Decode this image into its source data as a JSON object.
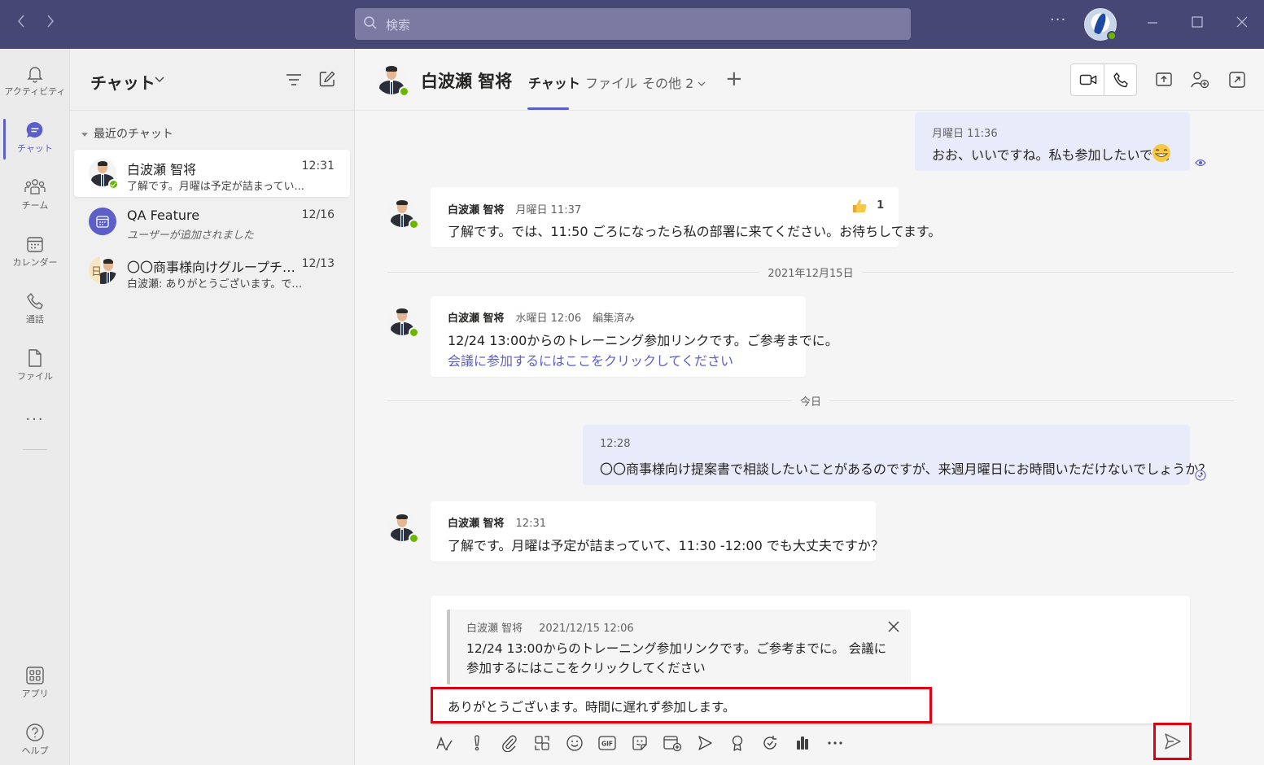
{
  "titlebar": {
    "search_placeholder": "検索",
    "more": "···"
  },
  "rail": {
    "items": [
      {
        "label": "アクティビティ",
        "icon": "bell-icon"
      },
      {
        "label": "チャット",
        "icon": "chat-icon",
        "active": true
      },
      {
        "label": "チーム",
        "icon": "teams-icon"
      },
      {
        "label": "カレンダー",
        "icon": "calendar-icon"
      },
      {
        "label": "通話",
        "icon": "phone-icon"
      },
      {
        "label": "ファイル",
        "icon": "file-icon"
      }
    ],
    "more": "···",
    "apps": "アプリ",
    "help": "ヘルプ"
  },
  "chatlist": {
    "title": "チャット",
    "section": "最近のチャット",
    "items": [
      {
        "name": "白波瀬 智将",
        "time": "12:31",
        "preview": "了解です。月曜は予定が詰まってい..."
      },
      {
        "name": "QA Feature",
        "time": "12/16",
        "preview": "ユーザーが追加されました"
      },
      {
        "name": "〇〇商事様向けグループチャ...",
        "time": "12/13",
        "preview": "白波瀬: ありがとうございます。では、...",
        "initial": "日"
      }
    ]
  },
  "header": {
    "name": "白波瀬 智将",
    "tabs": [
      "チャット",
      "ファイル",
      "その他 2"
    ],
    "plus": "+"
  },
  "messages": {
    "m1": {
      "meta": "月曜日 11:36",
      "text": "おお、いいですね。私も参加したいです。"
    },
    "m2": {
      "sender": "白波瀬 智将",
      "meta": "月曜日 11:37",
      "text": "了解です。では、11:50 ごろになったら私の部署に来てください。お待ちしてます。",
      "reaction_count": "1"
    },
    "sep1": "2021年12月15日",
    "m3": {
      "sender": "白波瀬 智将",
      "meta": "水曜日 12:06",
      "edited": "編集済み",
      "text": "12/24 13:00からのトレーニング参加リンクです。ご参考までに。",
      "link": "会議に参加するにはここをクリックしてください"
    },
    "sep2": "今日",
    "m4": {
      "meta": "12:28",
      "text": "〇〇商事様向け提案書で相談したいことがあるのですが、来週月曜日にお時間いただけないでしょうか？"
    },
    "m5": {
      "sender": "白波瀬 智将",
      "meta": "12:31",
      "text": "了解です。月曜は予定が詰まっていて、11:30 -12:00 でも大丈夫ですか？"
    }
  },
  "compose": {
    "quote_sender": "白波瀬 智将",
    "quote_time": "2021/12/15 12:06",
    "quote_text": "12/24 13:00からのトレーニング参加リンクです。ご参考までに。 会議に参加するにはここをクリックしてください",
    "input_value": "ありがとうございます。時間に遅れず参加します。"
  },
  "colors": {
    "titlebar": "#464775",
    "accent": "#5b5fc7",
    "mine_bubble": "#e8ebfa",
    "highlight": "#e00011",
    "presence": "#6bb700"
  }
}
